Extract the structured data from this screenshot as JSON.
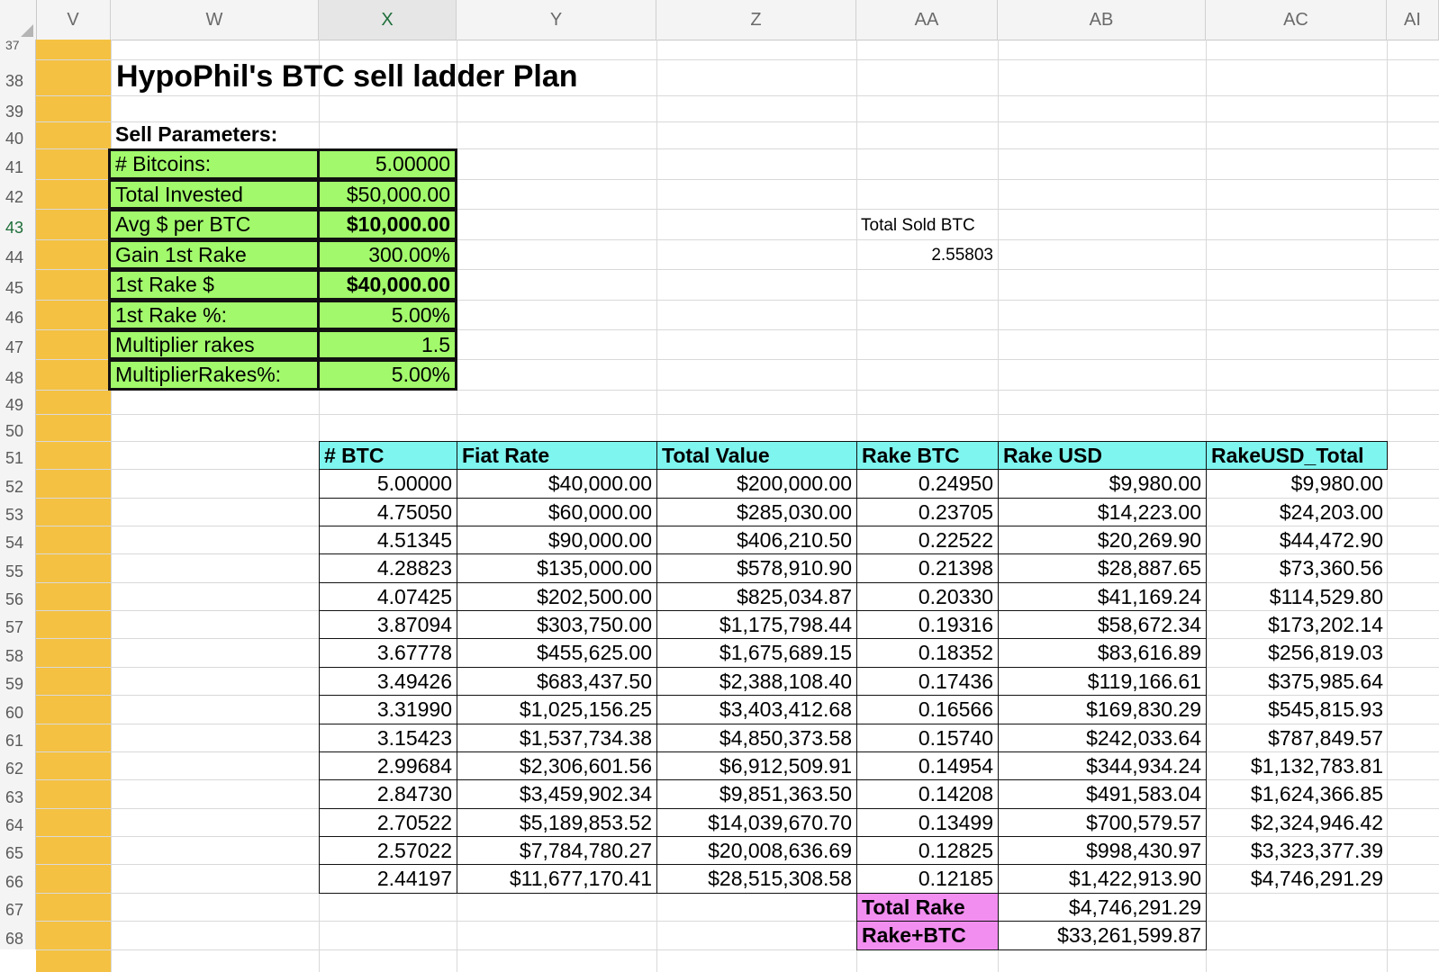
{
  "app": {
    "selected_column": "X",
    "selected_row": "43"
  },
  "columns": [
    "V",
    "W",
    "X",
    "Y",
    "Z",
    "AA",
    "AB",
    "AC",
    "AI"
  ],
  "rows": [
    "37",
    "38",
    "39",
    "40",
    "41",
    "42",
    "43",
    "44",
    "45",
    "46",
    "47",
    "48",
    "49",
    "50",
    "51",
    "52",
    "53",
    "54",
    "55",
    "56",
    "57",
    "58",
    "59",
    "60",
    "61",
    "62",
    "63",
    "64",
    "65",
    "66",
    "67",
    "68"
  ],
  "sheet": {
    "title": "HypoPhil's BTC sell ladder Plan",
    "params_heading": "Sell Parameters:",
    "params": [
      {
        "label": "# Bitcoins:",
        "value": "5.00000",
        "bold": false
      },
      {
        "label": "Total Invested",
        "value": "$50,000.00",
        "bold": false
      },
      {
        "label": "Avg $ per BTC",
        "value": "$10,000.00",
        "bold": true
      },
      {
        "label": "Gain 1st Rake",
        "value": "300.00%",
        "bold": false
      },
      {
        "label": "1st Rake $",
        "value": "$40,000.00",
        "bold": true
      },
      {
        "label": "1st Rake %:",
        "value": "5.00%",
        "bold": false
      },
      {
        "label": "Multiplier rakes",
        "value": "1.5",
        "bold": false
      },
      {
        "label": "MultiplierRakes%:",
        "value": "5.00%",
        "bold": false
      }
    ],
    "sold": {
      "label": "Total Sold BTC",
      "value": "2.55803"
    },
    "table": {
      "headers": [
        "# BTC",
        "Fiat Rate",
        "Total Value",
        "Rake BTC",
        "Rake USD",
        "RakeUSD_Total"
      ],
      "rows": [
        [
          "5.00000",
          "$40,000.00",
          "$200,000.00",
          "0.24950",
          "$9,980.00",
          "$9,980.00"
        ],
        [
          "4.75050",
          "$60,000.00",
          "$285,030.00",
          "0.23705",
          "$14,223.00",
          "$24,203.00"
        ],
        [
          "4.51345",
          "$90,000.00",
          "$406,210.50",
          "0.22522",
          "$20,269.90",
          "$44,472.90"
        ],
        [
          "4.28823",
          "$135,000.00",
          "$578,910.90",
          "0.21398",
          "$28,887.65",
          "$73,360.56"
        ],
        [
          "4.07425",
          "$202,500.00",
          "$825,034.87",
          "0.20330",
          "$41,169.24",
          "$114,529.80"
        ],
        [
          "3.87094",
          "$303,750.00",
          "$1,175,798.44",
          "0.19316",
          "$58,672.34",
          "$173,202.14"
        ],
        [
          "3.67778",
          "$455,625.00",
          "$1,675,689.15",
          "0.18352",
          "$83,616.89",
          "$256,819.03"
        ],
        [
          "3.49426",
          "$683,437.50",
          "$2,388,108.40",
          "0.17436",
          "$119,166.61",
          "$375,985.64"
        ],
        [
          "3.31990",
          "$1,025,156.25",
          "$3,403,412.68",
          "0.16566",
          "$169,830.29",
          "$545,815.93"
        ],
        [
          "3.15423",
          "$1,537,734.38",
          "$4,850,373.58",
          "0.15740",
          "$242,033.64",
          "$787,849.57"
        ],
        [
          "2.99684",
          "$2,306,601.56",
          "$6,912,509.91",
          "0.14954",
          "$344,934.24",
          "$1,132,783.81"
        ],
        [
          "2.84730",
          "$3,459,902.34",
          "$9,851,363.50",
          "0.14208",
          "$491,583.04",
          "$1,624,366.85"
        ],
        [
          "2.70522",
          "$5,189,853.52",
          "$14,039,670.70",
          "0.13499",
          "$700,579.57",
          "$2,324,946.42"
        ],
        [
          "2.57022",
          "$7,784,780.27",
          "$20,008,636.69",
          "0.12825",
          "$998,430.97",
          "$3,323,377.39"
        ],
        [
          "2.44197",
          "$11,677,170.41",
          "$28,515,308.58",
          "0.12185",
          "$1,422,913.90",
          "$4,746,291.29"
        ]
      ]
    },
    "totals": [
      {
        "label": "Total Rake",
        "value": "$4,746,291.29"
      },
      {
        "label": "Rake+BTC",
        "value": "$33,261,599.87"
      }
    ]
  },
  "colors": {
    "yellow_column": "#f4c142",
    "param_fill": "#a2f96b",
    "header_fill": "#7ef5ef",
    "total_fill": "#f28ef0"
  }
}
